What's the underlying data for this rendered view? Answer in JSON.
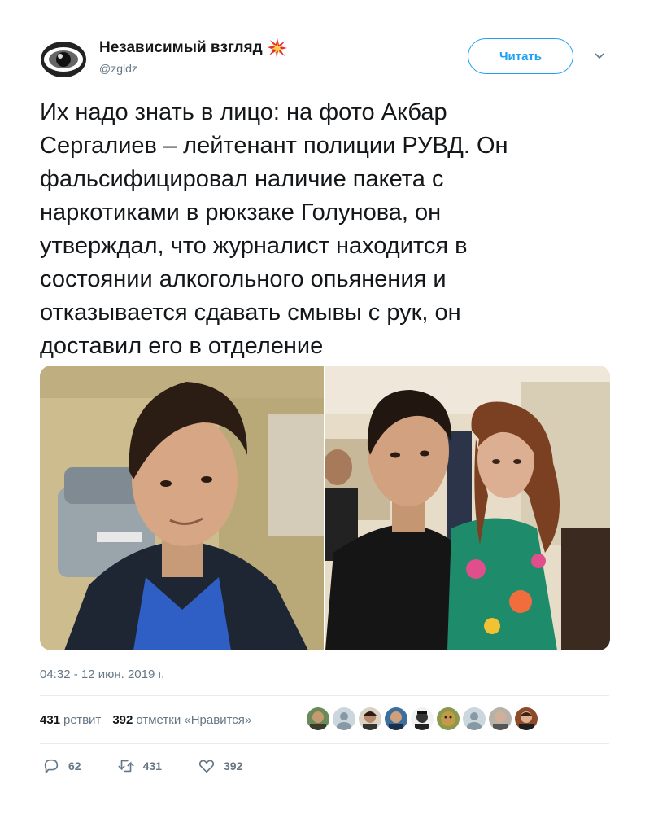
{
  "account": {
    "name": "Независимый взгляд",
    "handle": "@zgldz",
    "avatar_icon": "eye-icon",
    "badge_icon": "explosion-emoji"
  },
  "follow_button": {
    "label": "Читать"
  },
  "menu_icon": "chevron-down-icon",
  "tweet": {
    "text": "Их надо знать в лицо: на фото Акбар\nСергалиев – лейтенант полиции РУВД. Он\nфальсифицировал наличие пакета с\nнаркотиками в рюкзаке Голунова, он\nутверждал, что журналист находится в\nсостоянии алкогольного опьянения и\nотказывается сдавать смывы с рук, он\nдоставил его в отделение"
  },
  "media": {
    "photos": [
      "photo-left",
      "photo-right"
    ]
  },
  "timestamp": "04:32 - 12 июн. 2019 г.",
  "stats": {
    "retweets_count": "431",
    "retweets_label": "ретвит",
    "likes_count": "392",
    "likes_label": "отметки «Нравится»"
  },
  "likers_count": 9,
  "actions": {
    "replies": "62",
    "retweets": "431",
    "likes": "392"
  },
  "colors": {
    "accent": "#1da1f2",
    "secondary_text": "#657786",
    "divider": "#e6ecf0"
  }
}
